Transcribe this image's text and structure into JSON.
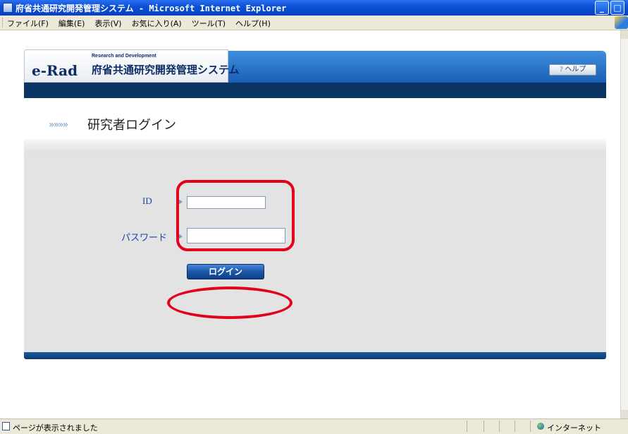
{
  "window": {
    "title": "府省共通研究開発管理システム - Microsoft Internet Explorer",
    "minimize_glyph": "_",
    "maximize_glyph": "□",
    "close_glyph": "×"
  },
  "menu": {
    "items": [
      "ファイル(F)",
      "編集(E)",
      "表示(V)",
      "お気に入り(A)",
      "ツール(T)",
      "ヘルプ(H)"
    ]
  },
  "site": {
    "logo_erad": "e-Rad",
    "logo_tagline": "Research and Development",
    "logo_japanese": "府省共通研究開発管理システム",
    "help_icon": "?",
    "help_label": "ヘルプ"
  },
  "page": {
    "chevrons": "»»»»",
    "title": "研究者ログイン"
  },
  "form": {
    "id_label": "ID",
    "id_value": "",
    "password_label": "パスワード",
    "password_value": "",
    "login_label": "ログイン"
  },
  "status": {
    "message": "ページが表示されました",
    "zone": "インターネット"
  },
  "colors": {
    "annotation": "#e2001a",
    "header_blue": "#1a5fb4",
    "nav_navy": "#0a3462",
    "label_blue": "#1b44a8"
  },
  "icons": [
    "app-icon",
    "ie-logo-icon",
    "help-icon",
    "arrow-icon",
    "page-icon",
    "globe-icon"
  ]
}
